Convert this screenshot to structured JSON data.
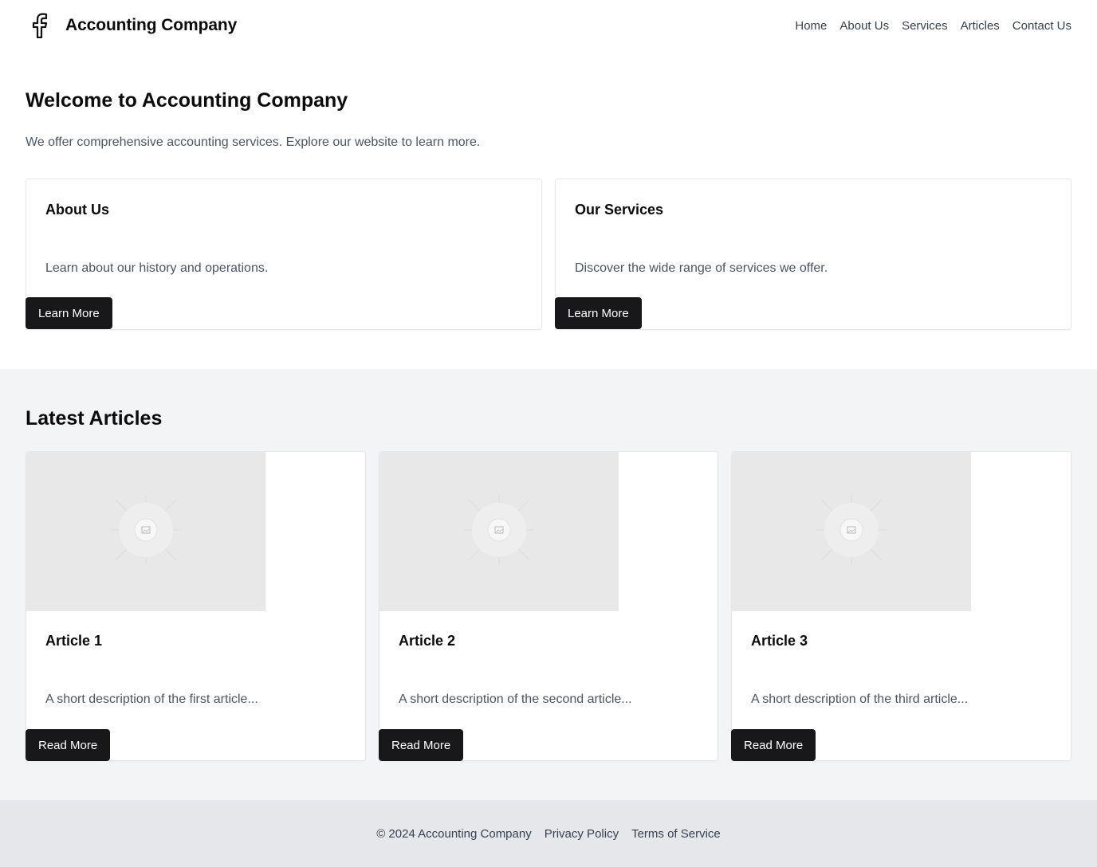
{
  "header": {
    "brand_name": "Accounting Company",
    "brand_icon": "facebook-icon",
    "nav": [
      "Home",
      "About Us",
      "Services",
      "Articles",
      "Contact Us"
    ]
  },
  "hero": {
    "title": "Welcome to Accounting Company",
    "subtitle": "We offer comprehensive accounting services. Explore our website to learn more."
  },
  "feature_cards": [
    {
      "title": "About Us",
      "text": "Learn about our history and operations.",
      "button": "Learn More"
    },
    {
      "title": "Our Services",
      "text": "Discover the wide range of services we offer.",
      "button": "Learn More"
    }
  ],
  "articles": {
    "heading": "Latest Articles",
    "items": [
      {
        "title": "Article 1",
        "text": "A short description of the first article...",
        "button": "Read More",
        "image_icon": "image-placeholder-icon"
      },
      {
        "title": "Article 2",
        "text": "A short description of the second article...",
        "button": "Read More",
        "image_icon": "image-placeholder-icon"
      },
      {
        "title": "Article 3",
        "text": "A short description of the third article...",
        "button": "Read More",
        "image_icon": "image-placeholder-icon"
      }
    ]
  },
  "footer": {
    "copyright": "© 2024 Accounting Company",
    "links": [
      "Privacy Policy",
      "Terms of Service"
    ]
  },
  "colors": {
    "button_bg": "#18181b",
    "section_bg": "#f3f4f6",
    "footer_bg": "#e5e7eb",
    "muted_text": "#4b5563"
  }
}
